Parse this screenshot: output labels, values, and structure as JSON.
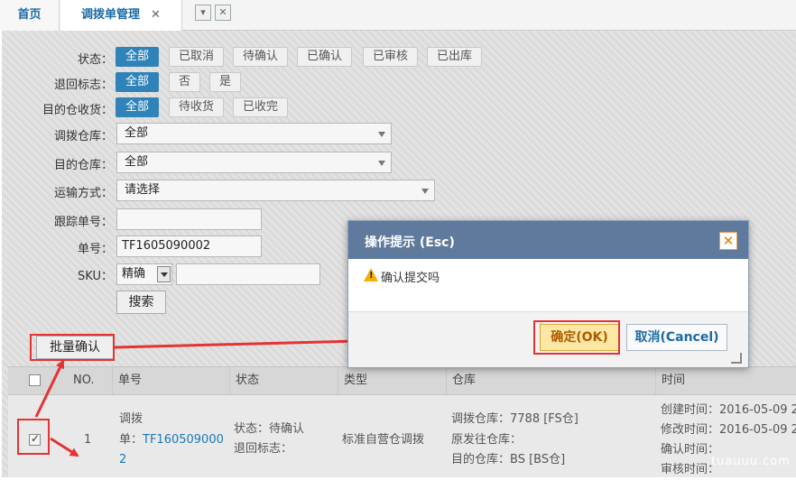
{
  "tabs": {
    "home": "首页",
    "active": "调拨单管理",
    "close_glyph": "✕"
  },
  "filters": {
    "status": {
      "label": "状态：",
      "options": [
        "全部",
        "已取消",
        "待确认",
        "已确认",
        "已审核",
        "已出库"
      ],
      "selected": 0
    },
    "return_flag": {
      "label": "退回标志：",
      "options": [
        "全部",
        "否",
        "是"
      ],
      "selected": 0
    },
    "dest_receive": {
      "label": "目的仓收货：",
      "options": [
        "全部",
        "待收货",
        "已收完"
      ],
      "selected": 0
    },
    "transfer_wh": {
      "label": "调拨仓库：",
      "value": "全部"
    },
    "dest_wh": {
      "label": "目的仓库：",
      "value": "全部"
    },
    "shipping": {
      "label": "运输方式：",
      "value": "请选择"
    },
    "tracking": {
      "label": "跟踪单号：",
      "value": ""
    },
    "order_no": {
      "label": "单号：",
      "value": "TF1605090002"
    },
    "sku": {
      "label": "SKU：",
      "mode": "精确",
      "value": ""
    },
    "search_label": "搜索"
  },
  "batch_confirm_label": "批量确认",
  "grid": {
    "headers": [
      "NO.",
      "单号",
      "状态",
      "类型",
      "仓库",
      "时间"
    ],
    "row": {
      "no": "1",
      "order_prefix": "调拨",
      "order_label": "单：",
      "order_link1": "TF160509000",
      "order_link2": "2",
      "status1": "状态：待确认",
      "status2": "退回标志：",
      "type": "标准自营仓调拨",
      "wh1": "调拨仓库：7788 [FS仓]",
      "wh2": "原发往仓库：",
      "wh3": "目的仓库：BS [BS仓]",
      "t1": "创建时间：2016-05-09 2",
      "t2": "修改时间：2016-05-09 2",
      "t3": "确认时间：",
      "t4": "审核时间："
    }
  },
  "dialog": {
    "title": "操作提示 (Esc)",
    "message": "确认提交吗",
    "ok": "确定(OK)",
    "cancel": "取消(Cancel)"
  },
  "watermark": "tuauuu.com",
  "colors": {
    "accent": "#2f83b8",
    "dialog_header": "#5f7a9c",
    "annotation_red": "#e53333"
  }
}
